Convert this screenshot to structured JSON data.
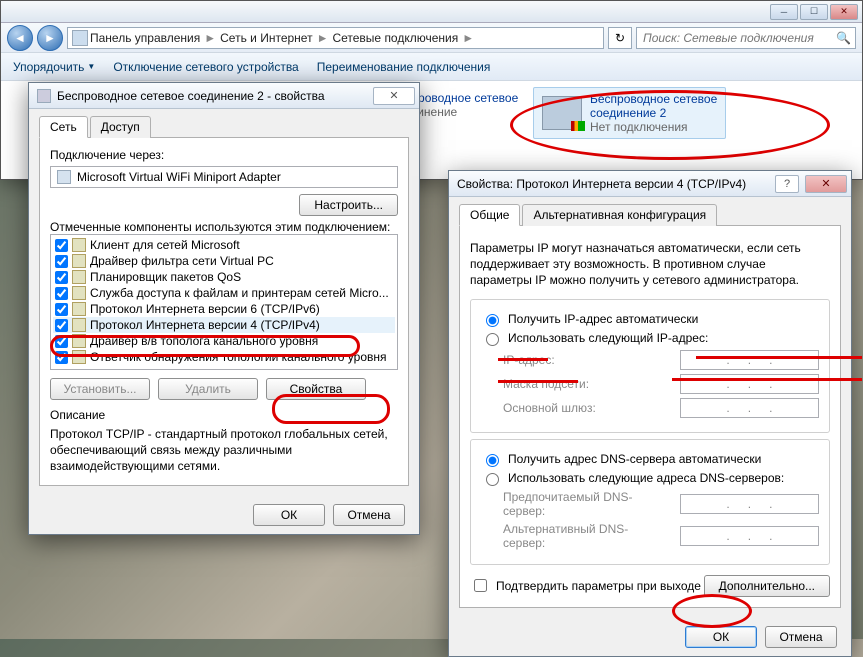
{
  "explorer": {
    "breadcrumb": {
      "root": "Панель управления",
      "l1": "Сеть и Интернет",
      "l2": "Сетевые подключения"
    },
    "search_placeholder": "Поиск: Сетевые подключения",
    "toolbar": {
      "organize": "Упорядочить",
      "disable": "Отключение сетевого устройства",
      "rename": "Переименование подключения"
    },
    "conn1": {
      "title": "Беспроводное сетевое",
      "sub": "соединение"
    },
    "conn2": {
      "title": "Беспроводное сетевое",
      "title2": "соединение 2",
      "status": "Нет подключения"
    }
  },
  "props": {
    "title": "Беспроводное сетевое соединение 2 - свойства",
    "tab_network": "Сеть",
    "tab_access": "Доступ",
    "connect_via": "Подключение через:",
    "adapter": "Microsoft Virtual WiFi Miniport Adapter",
    "configure": "Настроить...",
    "components_label": "Отмеченные компоненты используются этим подключением:",
    "components": [
      "Клиент для сетей Microsoft",
      "Драйвер фильтра сети Virtual PC",
      "Планировщик пакетов QoS",
      "Служба доступа к файлам и принтерам сетей Micro...",
      "Протокол Интернета версии 6 (TCP/IPv6)",
      "Протокол Интернета версии 4 (TCP/IPv4)",
      "Драйвер в/в тополога канального уровня",
      "Ответчик обнаружения топологии канального уровня"
    ],
    "install": "Установить...",
    "remove": "Удалить",
    "properties": "Свойства",
    "desc_label": "Описание",
    "desc_text": "Протокол TCP/IP - стандартный протокол глобальных сетей, обеспечивающий связь между различными взаимодействующими сетями.",
    "ok": "ОК",
    "cancel": "Отмена"
  },
  "ipv4": {
    "title": "Свойства: Протокол Интернета версии 4 (TCP/IPv4)",
    "tab_general": "Общие",
    "tab_alt": "Альтернативная конфигурация",
    "intro": "Параметры IP могут назначаться автоматически, если сеть поддерживает эту возможность. В противном случае параметры IP можно получить у сетевого администратора.",
    "ip_auto": "Получить IP-адрес автоматически",
    "ip_manual": "Использовать следующий IP-адрес:",
    "ip_addr": "IP-адрес:",
    "mask": "Маска подсети:",
    "gateway": "Основной шлюз:",
    "dns_auto": "Получить адрес DNS-сервера автоматически",
    "dns_manual": "Использовать следующие адреса DNS-серверов:",
    "dns_pref": "Предпочитаемый DNS-сервер:",
    "dns_alt": "Альтернативный DNS-сервер:",
    "confirm_exit": "Подтвердить параметры при выходе",
    "advanced": "Дополнительно...",
    "ok": "ОК",
    "cancel": "Отмена"
  }
}
